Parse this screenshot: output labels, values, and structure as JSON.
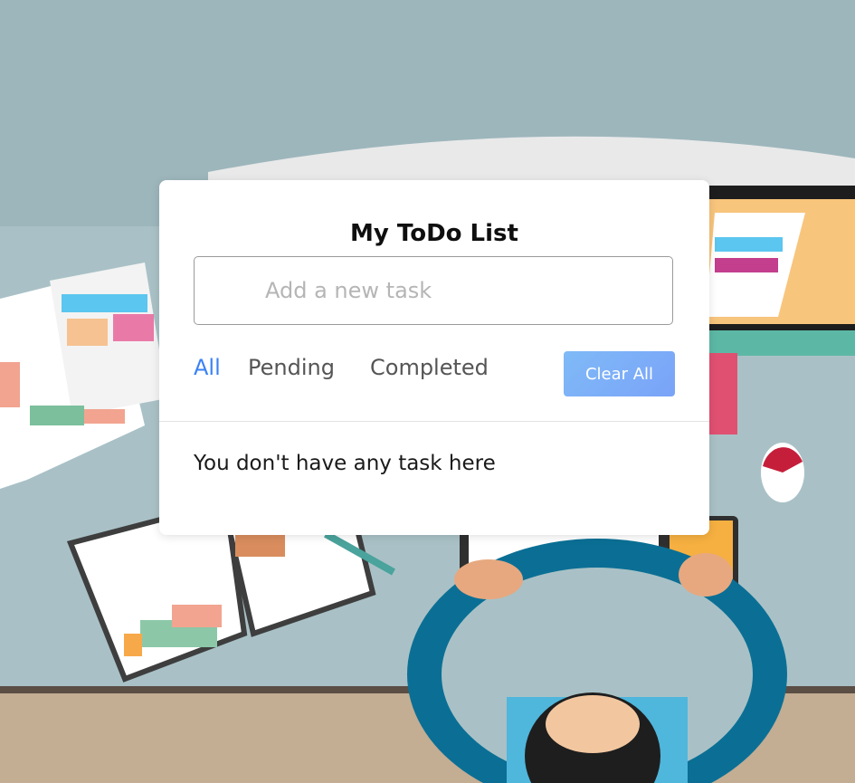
{
  "app": {
    "title": "My ToDo List",
    "input": {
      "placeholder": "Add a new task",
      "value": ""
    },
    "filters": [
      {
        "label": "All",
        "active": true
      },
      {
        "label": "Pending",
        "active": false
      },
      {
        "label": "Completed",
        "active": false
      }
    ],
    "clear_button_label": "Clear All",
    "empty_message": "You don't have any task here"
  },
  "colors": {
    "accent": "#3b82f6",
    "button_gradient_start": "#7fbaf7",
    "button_gradient_end": "#7aa3f8"
  }
}
